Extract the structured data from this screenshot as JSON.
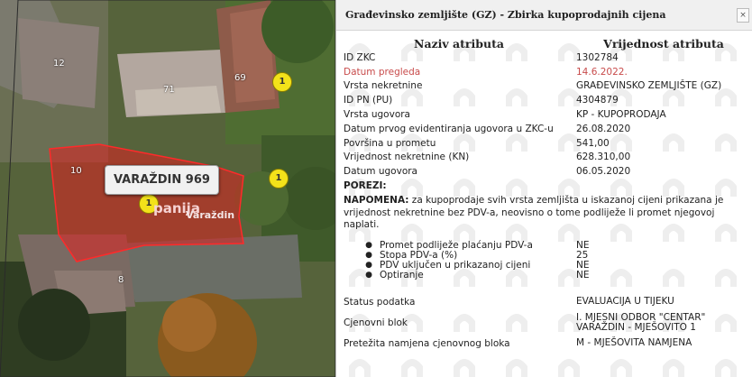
{
  "map": {
    "label": "VARAŽDIN 969",
    "parcel_numbers": [
      "12",
      "71",
      "69",
      "10",
      "8"
    ],
    "markers": [
      "1",
      "1",
      "1",
      "1"
    ],
    "overlay_text_top": "a",
    "overlay_text_mid": "panija",
    "overlay_text_small": "Varaždin",
    "parcel_color": "#e02020"
  },
  "panel": {
    "title": "Građevinsko zemljište (GZ) - Zbirka kupoprodajnih cijena",
    "close_label": "×",
    "header_attr": "Naziv atributa",
    "header_val": "Vrijednost atributa",
    "rows": [
      {
        "k": "ID ZKC",
        "v": "1302784"
      },
      {
        "k": "Datum pregleda",
        "v": "14.6.2022."
      },
      {
        "k": "Vrsta nekretnine",
        "v": "GRAĐEVINSKO ZEMLJIŠTE (GZ)"
      },
      {
        "k": "ID PN (PU)",
        "v": "4304879"
      },
      {
        "k": "Vrsta ugovora",
        "v": "KP - KUPOPRODAJA"
      },
      {
        "k": "Datum prvog evidentiranja ugovora u ZKC-u",
        "v": "26.08.2020"
      },
      {
        "k": "Površina u prometu",
        "v": "541,00"
      },
      {
        "k": "Vrijednost nekretnine (KN)",
        "v": "628.310,00"
      },
      {
        "k": "Datum ugovora",
        "v": "06.05.2020"
      }
    ],
    "porezi": "POREZI:",
    "note_bold": "NAPOMENA:",
    "note_text": " za kupoprodaje svih vrsta zemljišta u iskazanoj cijeni prikazana je vrijednost nekretnine bez PDV-a, neovisno o tome podliježe li promet njegovoj naplati.",
    "taxes": [
      {
        "k": "Promet podliježe plaćanju PDV-a",
        "v": "NE"
      },
      {
        "k": "Stopa PDV-a (%)",
        "v": "25"
      },
      {
        "k": "PDV uključen u prikazanoj cijeni",
        "v": "NE"
      },
      {
        "k": "Optiranje",
        "v": "NE"
      }
    ],
    "status_k": "Status podatka",
    "status_v": "EVALUACIJA U TIJEKU",
    "blok_k": "Cjenovni blok",
    "blok_v1": "I. MJESNI ODBOR \"CENTAR\"",
    "blok_v2": "VARAŽDIN - MJEŠOVITO 1",
    "namjena_k": "Pretežita namjena cjenovnog bloka",
    "namjena_v": "M - MJEŠOVITA NAMJENA"
  }
}
